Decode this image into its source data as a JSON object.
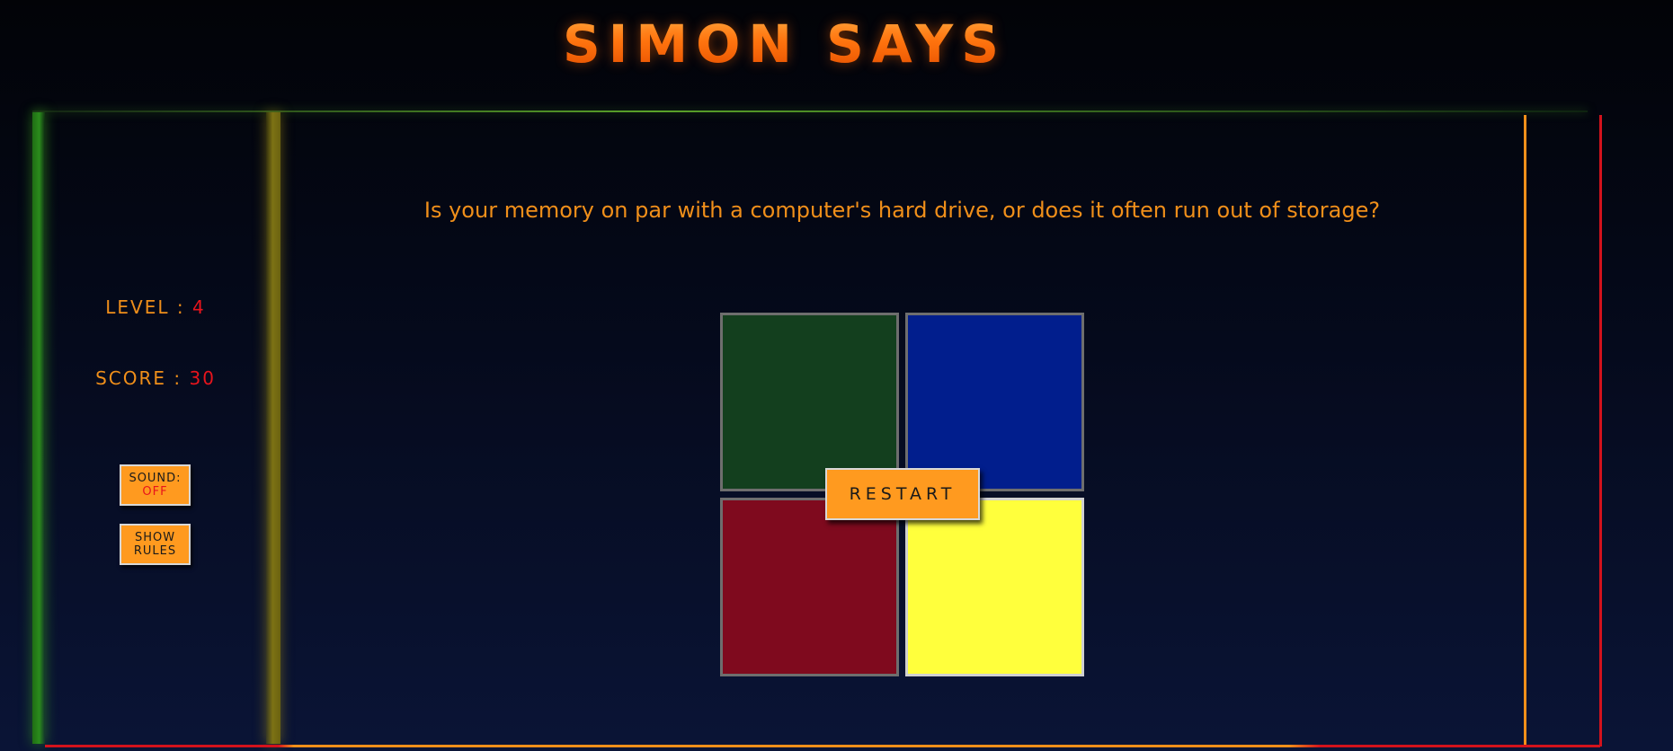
{
  "header": {
    "title": "SIMON SAYS"
  },
  "sidebar": {
    "level_label": "LEVEL : ",
    "level_value": "4",
    "score_label": "SCORE : ",
    "score_value": "30",
    "sound_label": "SOUND:",
    "sound_state": "OFF",
    "rules_line1": "SHOW",
    "rules_line2": "RULES"
  },
  "main": {
    "question": "Is your memory on par with a computer's hard drive, or does it often run out of storage?",
    "restart_label": "RESTART"
  },
  "pads": {
    "green": "#133f1e",
    "blue": "#011e8d",
    "red": "#7f0a1e",
    "yellow": "#ffff3c"
  },
  "theme": {
    "accent": "#f08f1a",
    "value_red": "#e8141c",
    "button_bg": "#ff9a1f"
  }
}
